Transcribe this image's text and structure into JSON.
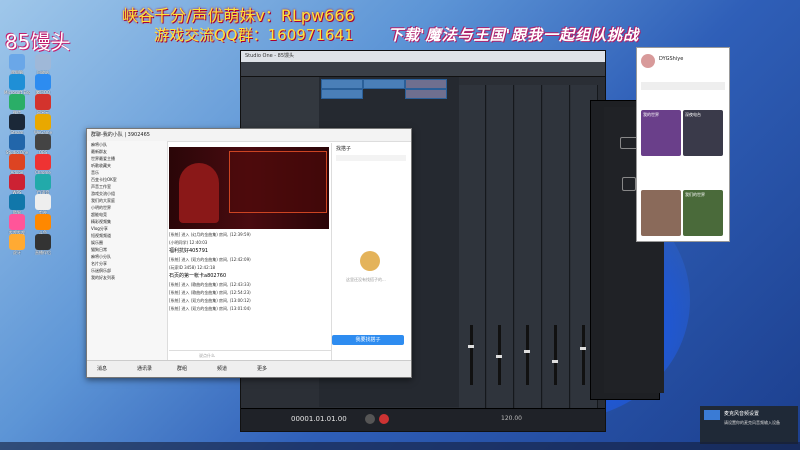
{
  "overlay": {
    "line1": "峡谷千分/声优萌妹v：RLpw666",
    "line2": "游戏交流QQ群：160971641",
    "line3": "下载'魔法与王国'跟我一起组队挑战",
    "badge": "85馒头"
  },
  "qq_window": {
    "title": "群聊-我的小队 | 3902465",
    "panel_tab": "找搭子",
    "empty_hint": "这里还没有找搭子的...",
    "post_button": "我要找搭子",
    "input_placeholder": "说点什么",
    "messages": [
      {
        "text": "[系统] 进入 (幻月的金曲集) 房间, (12:39:59)",
        "big": false
      },
      {
        "text": "(小明同学) 12:40:03",
        "big": false
      },
      {
        "text": "福利抗好405791",
        "big": true
      },
      {
        "text": "[系统] 进入 (双方的金曲集) 房间, (12:42:09)",
        "big": false
      },
      {
        "text": "(玩家ID 3458) 12:42:18",
        "big": false
      },
      {
        "text": "石页的第一帐卡a802760",
        "big": true
      },
      {
        "text": "[系统] 进入 (歌曲的金曲集) 房间, (12:43:33)",
        "big": false
      },
      {
        "text": "[系统] 进入 (歌曲的金曲集) 房间, (12:54:23)",
        "big": false
      },
      {
        "text": "[系统] 进入 (双方的金曲集) 房间, (13:00:12)",
        "big": false
      },
      {
        "text": "[系统] 进入 (双方的金曲集) 房间, (13:01:04)",
        "big": false
      }
    ],
    "sidebar_items": [
      "麻将小队",
      "最新群友",
      "世界最爱主播",
      "听歌收藏夹",
      "音乐",
      "百变卡拉OK室",
      "声音工作室",
      "游戏交流小组",
      "我们的大家庭",
      "小明的世界",
      "超能电竞",
      "精彩视频集",
      "Vlog分享",
      "短视频频道",
      "娱乐圈",
      "猫狗日常",
      "麻将小分队",
      "名片分享",
      "乐迷俱乐部",
      "我的好友列表"
    ],
    "bottom_tabs": [
      "消息",
      "通讯录",
      "群组",
      "频道",
      "更多"
    ]
  },
  "daw_window": {
    "title": "Studio One - 85馒头",
    "timecode": "00001.01.01.00",
    "bpm": "120.00"
  },
  "streamer_panel": {
    "name": "DYGShiye",
    "card_titles": [
      "我的世界",
      "深夜电台",
      "我们的世界"
    ]
  },
  "notification": {
    "title": "麦克风音频设置",
    "text": "请设置你的麦克风音频输入设备"
  },
  "desktop_icons": [
    "此电脑",
    "回收站",
    "Microsoft Edge",
    "腾讯QQ",
    "微信",
    "网易云",
    "Steam",
    "WeGame",
    "Studio One",
    "OBS",
    "Adobe",
    "Chrome",
    "WPS",
    "YY语音",
    "酷狗",
    "剪映",
    "哔哩哔哩",
    "斗鱼",
    "虎牙",
    "直播伴侣"
  ]
}
